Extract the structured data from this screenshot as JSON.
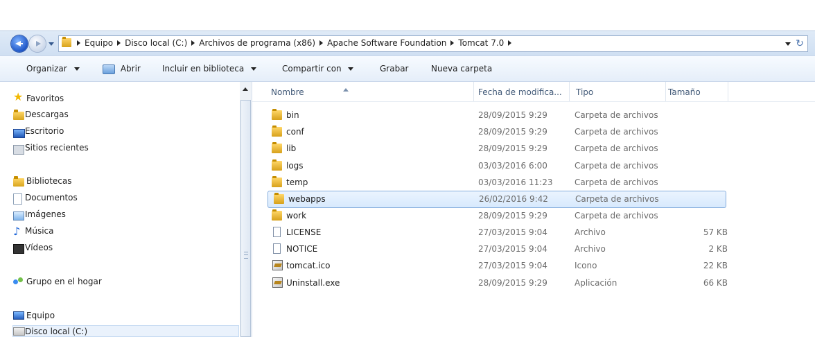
{
  "address": {
    "segments": [
      "Equipo",
      "Disco local (C:)",
      "Archivos de programa (x86)",
      "Apache Software Foundation",
      "Tomcat 7.0"
    ]
  },
  "toolbar": {
    "organize": "Organizar",
    "open": "Abrir",
    "include": "Incluir en biblioteca",
    "share": "Compartir con",
    "burn": "Grabar",
    "new_folder": "Nueva carpeta"
  },
  "sidebar": {
    "favorites": "Favoritos",
    "downloads": "Descargas",
    "desktop": "Escritorio",
    "recent": "Sitios recientes",
    "libraries": "Bibliotecas",
    "documents": "Documentos",
    "images": "Imágenes",
    "music": "Música",
    "videos": "Vídeos",
    "homegroup": "Grupo en el hogar",
    "computer": "Equipo",
    "local_disk": "Disco local (C:)"
  },
  "columns": {
    "name": "Nombre",
    "date": "Fecha de modifica...",
    "type": "Tipo",
    "size": "Tamaño"
  },
  "files": [
    {
      "name": "bin",
      "date": "28/09/2015 9:29",
      "type": "Carpeta de archivos",
      "size": ""
    },
    {
      "name": "conf",
      "date": "28/09/2015 9:29",
      "type": "Carpeta de archivos",
      "size": ""
    },
    {
      "name": "lib",
      "date": "28/09/2015 9:29",
      "type": "Carpeta de archivos",
      "size": ""
    },
    {
      "name": "logs",
      "date": "03/03/2016 6:00",
      "type": "Carpeta de archivos",
      "size": ""
    },
    {
      "name": "temp",
      "date": "03/03/2016 11:23",
      "type": "Carpeta de archivos",
      "size": ""
    },
    {
      "name": "webapps",
      "date": "26/02/2016 9:42",
      "type": "Carpeta de archivos",
      "size": ""
    },
    {
      "name": "work",
      "date": "28/09/2015 9:29",
      "type": "Carpeta de archivos",
      "size": ""
    },
    {
      "name": "LICENSE",
      "date": "27/03/2015 9:04",
      "type": "Archivo",
      "size": "57 KB"
    },
    {
      "name": "NOTICE",
      "date": "27/03/2015 9:04",
      "type": "Archivo",
      "size": "2 KB"
    },
    {
      "name": "tomcat.ico",
      "date": "27/03/2015 9:04",
      "type": "Icono",
      "size": "22 KB"
    },
    {
      "name": "Uninstall.exe",
      "date": "28/09/2015 9:29",
      "type": "Aplicación",
      "size": "66 KB"
    }
  ]
}
